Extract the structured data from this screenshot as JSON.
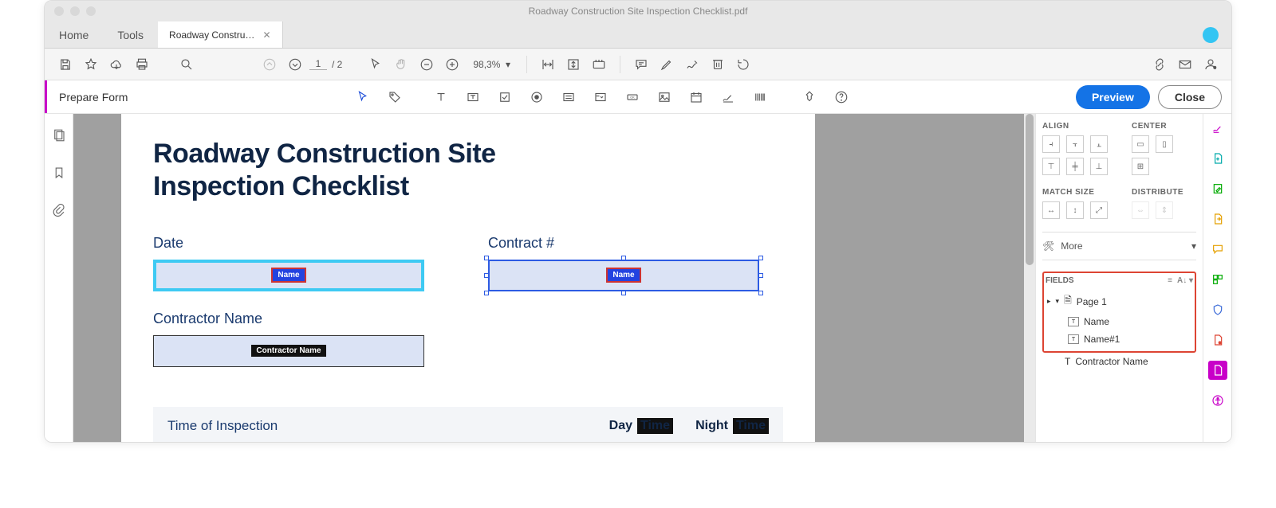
{
  "window": {
    "title": "Roadway Construction Site Inspection Checklist.pdf"
  },
  "tabs": {
    "home": "Home",
    "tools": "Tools",
    "doc": "Roadway Constru…"
  },
  "toolbar": {
    "page_current": "1",
    "page_total": "/  2",
    "zoom": "98,3%"
  },
  "formbar": {
    "label": "Prepare Form",
    "preview": "Preview",
    "close": "Close"
  },
  "doc": {
    "title_line1": "Roadway Construction Site",
    "title_line2": "Inspection Checklist",
    "date_label": "Date",
    "contract_label": "Contract #",
    "contractor_label": "Contractor Name",
    "field_date_name": "Name",
    "field_contract_name": "Name",
    "field_contractor_name": "Contractor Name",
    "section_time": "Time of Inspection",
    "day": "Day",
    "night": "Night",
    "time_badge": "Time"
  },
  "panel": {
    "align": "ALIGN",
    "center": "CENTER",
    "match": "MATCH SIZE",
    "distribute": "DISTRIBUTE",
    "more": "More",
    "fields": "FIELDS",
    "page1": "Page 1",
    "name1": "Name",
    "name2": "Name#1",
    "contractor": "Contractor Name"
  }
}
